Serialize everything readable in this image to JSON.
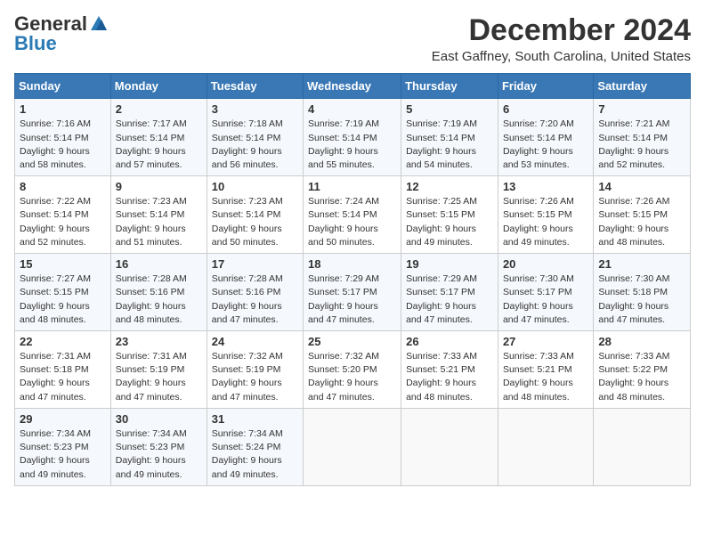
{
  "header": {
    "logo_general": "General",
    "logo_blue": "Blue",
    "month_title": "December 2024",
    "location": "East Gaffney, South Carolina, United States"
  },
  "days_of_week": [
    "Sunday",
    "Monday",
    "Tuesday",
    "Wednesday",
    "Thursday",
    "Friday",
    "Saturday"
  ],
  "weeks": [
    [
      {
        "num": "1",
        "sunrise": "Sunrise: 7:16 AM",
        "sunset": "Sunset: 5:14 PM",
        "daylight": "Daylight: 9 hours and 58 minutes."
      },
      {
        "num": "2",
        "sunrise": "Sunrise: 7:17 AM",
        "sunset": "Sunset: 5:14 PM",
        "daylight": "Daylight: 9 hours and 57 minutes."
      },
      {
        "num": "3",
        "sunrise": "Sunrise: 7:18 AM",
        "sunset": "Sunset: 5:14 PM",
        "daylight": "Daylight: 9 hours and 56 minutes."
      },
      {
        "num": "4",
        "sunrise": "Sunrise: 7:19 AM",
        "sunset": "Sunset: 5:14 PM",
        "daylight": "Daylight: 9 hours and 55 minutes."
      },
      {
        "num": "5",
        "sunrise": "Sunrise: 7:19 AM",
        "sunset": "Sunset: 5:14 PM",
        "daylight": "Daylight: 9 hours and 54 minutes."
      },
      {
        "num": "6",
        "sunrise": "Sunrise: 7:20 AM",
        "sunset": "Sunset: 5:14 PM",
        "daylight": "Daylight: 9 hours and 53 minutes."
      },
      {
        "num": "7",
        "sunrise": "Sunrise: 7:21 AM",
        "sunset": "Sunset: 5:14 PM",
        "daylight": "Daylight: 9 hours and 52 minutes."
      }
    ],
    [
      {
        "num": "8",
        "sunrise": "Sunrise: 7:22 AM",
        "sunset": "Sunset: 5:14 PM",
        "daylight": "Daylight: 9 hours and 52 minutes."
      },
      {
        "num": "9",
        "sunrise": "Sunrise: 7:23 AM",
        "sunset": "Sunset: 5:14 PM",
        "daylight": "Daylight: 9 hours and 51 minutes."
      },
      {
        "num": "10",
        "sunrise": "Sunrise: 7:23 AM",
        "sunset": "Sunset: 5:14 PM",
        "daylight": "Daylight: 9 hours and 50 minutes."
      },
      {
        "num": "11",
        "sunrise": "Sunrise: 7:24 AM",
        "sunset": "Sunset: 5:14 PM",
        "daylight": "Daylight: 9 hours and 50 minutes."
      },
      {
        "num": "12",
        "sunrise": "Sunrise: 7:25 AM",
        "sunset": "Sunset: 5:15 PM",
        "daylight": "Daylight: 9 hours and 49 minutes."
      },
      {
        "num": "13",
        "sunrise": "Sunrise: 7:26 AM",
        "sunset": "Sunset: 5:15 PM",
        "daylight": "Daylight: 9 hours and 49 minutes."
      },
      {
        "num": "14",
        "sunrise": "Sunrise: 7:26 AM",
        "sunset": "Sunset: 5:15 PM",
        "daylight": "Daylight: 9 hours and 48 minutes."
      }
    ],
    [
      {
        "num": "15",
        "sunrise": "Sunrise: 7:27 AM",
        "sunset": "Sunset: 5:15 PM",
        "daylight": "Daylight: 9 hours and 48 minutes."
      },
      {
        "num": "16",
        "sunrise": "Sunrise: 7:28 AM",
        "sunset": "Sunset: 5:16 PM",
        "daylight": "Daylight: 9 hours and 48 minutes."
      },
      {
        "num": "17",
        "sunrise": "Sunrise: 7:28 AM",
        "sunset": "Sunset: 5:16 PM",
        "daylight": "Daylight: 9 hours and 47 minutes."
      },
      {
        "num": "18",
        "sunrise": "Sunrise: 7:29 AM",
        "sunset": "Sunset: 5:17 PM",
        "daylight": "Daylight: 9 hours and 47 minutes."
      },
      {
        "num": "19",
        "sunrise": "Sunrise: 7:29 AM",
        "sunset": "Sunset: 5:17 PM",
        "daylight": "Daylight: 9 hours and 47 minutes."
      },
      {
        "num": "20",
        "sunrise": "Sunrise: 7:30 AM",
        "sunset": "Sunset: 5:17 PM",
        "daylight": "Daylight: 9 hours and 47 minutes."
      },
      {
        "num": "21",
        "sunrise": "Sunrise: 7:30 AM",
        "sunset": "Sunset: 5:18 PM",
        "daylight": "Daylight: 9 hours and 47 minutes."
      }
    ],
    [
      {
        "num": "22",
        "sunrise": "Sunrise: 7:31 AM",
        "sunset": "Sunset: 5:18 PM",
        "daylight": "Daylight: 9 hours and 47 minutes."
      },
      {
        "num": "23",
        "sunrise": "Sunrise: 7:31 AM",
        "sunset": "Sunset: 5:19 PM",
        "daylight": "Daylight: 9 hours and 47 minutes."
      },
      {
        "num": "24",
        "sunrise": "Sunrise: 7:32 AM",
        "sunset": "Sunset: 5:19 PM",
        "daylight": "Daylight: 9 hours and 47 minutes."
      },
      {
        "num": "25",
        "sunrise": "Sunrise: 7:32 AM",
        "sunset": "Sunset: 5:20 PM",
        "daylight": "Daylight: 9 hours and 47 minutes."
      },
      {
        "num": "26",
        "sunrise": "Sunrise: 7:33 AM",
        "sunset": "Sunset: 5:21 PM",
        "daylight": "Daylight: 9 hours and 48 minutes."
      },
      {
        "num": "27",
        "sunrise": "Sunrise: 7:33 AM",
        "sunset": "Sunset: 5:21 PM",
        "daylight": "Daylight: 9 hours and 48 minutes."
      },
      {
        "num": "28",
        "sunrise": "Sunrise: 7:33 AM",
        "sunset": "Sunset: 5:22 PM",
        "daylight": "Daylight: 9 hours and 48 minutes."
      }
    ],
    [
      {
        "num": "29",
        "sunrise": "Sunrise: 7:34 AM",
        "sunset": "Sunset: 5:23 PM",
        "daylight": "Daylight: 9 hours and 49 minutes."
      },
      {
        "num": "30",
        "sunrise": "Sunrise: 7:34 AM",
        "sunset": "Sunset: 5:23 PM",
        "daylight": "Daylight: 9 hours and 49 minutes."
      },
      {
        "num": "31",
        "sunrise": "Sunrise: 7:34 AM",
        "sunset": "Sunset: 5:24 PM",
        "daylight": "Daylight: 9 hours and 49 minutes."
      },
      null,
      null,
      null,
      null
    ]
  ]
}
